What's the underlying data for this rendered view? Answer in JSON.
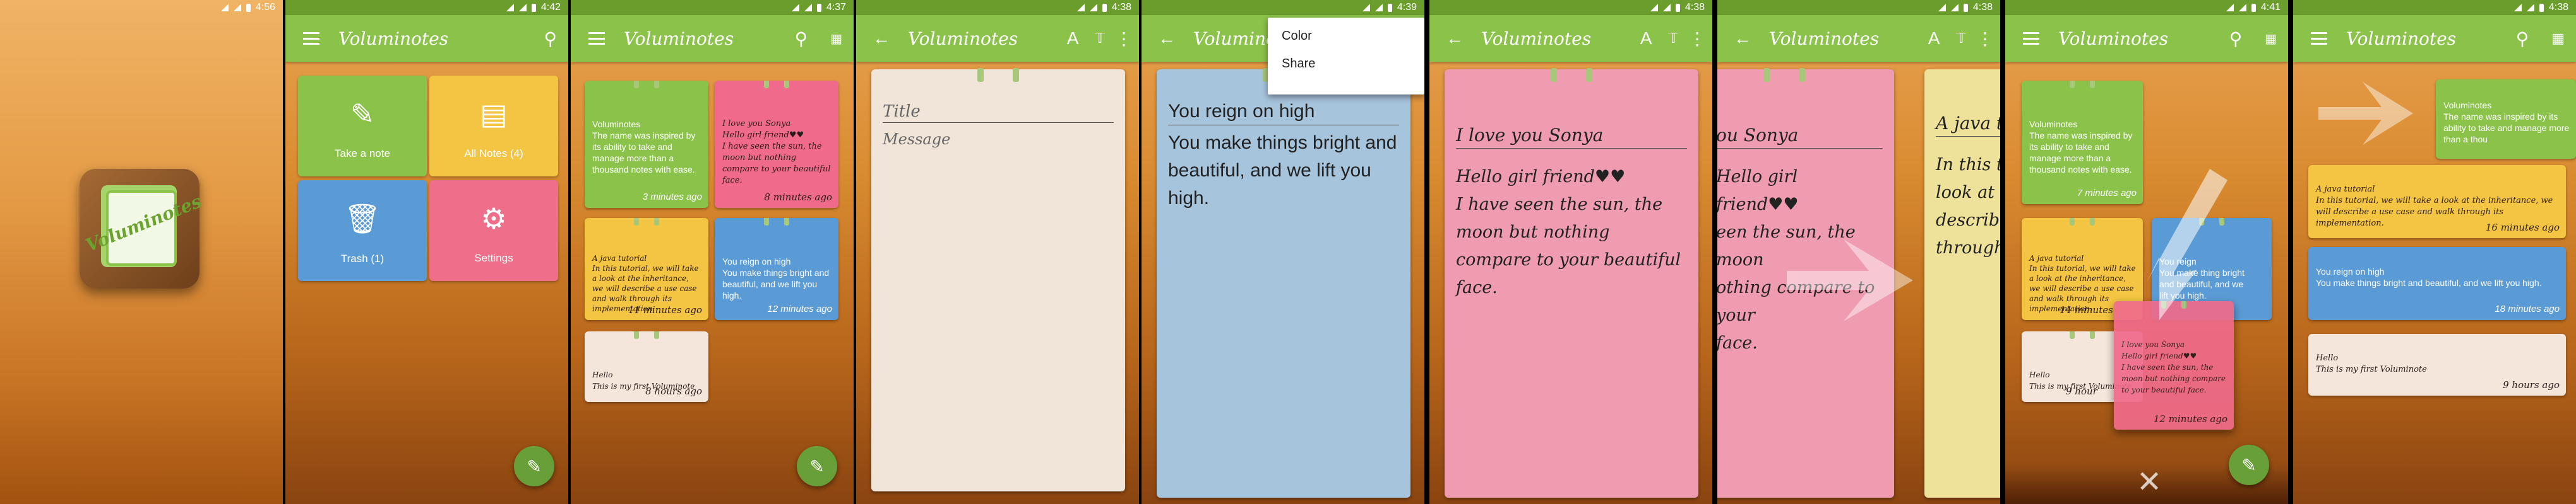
{
  "app": {
    "name": "Voluminotes",
    "brand_color": "#8bc34a",
    "dark_green": "#6a9d2c"
  },
  "status": {
    "s1": "4:56",
    "s2": "4:42",
    "s3": "4:37",
    "s4": "4:38",
    "s5": "4:39",
    "s6": "4:38",
    "s7": "4:38",
    "s8": "4:41",
    "s9": "4:38"
  },
  "splash": {
    "logo_text": "Voluminotes"
  },
  "home": {
    "tiles": [
      {
        "label": "Take a note",
        "icon": "pencil-icon",
        "color": "#8bc34a"
      },
      {
        "label": "All Notes (4)",
        "icon": "notes-icon",
        "color": "#f4c542"
      },
      {
        "label": "Trash (1)",
        "icon": "trash-icon",
        "color": "#5b9bd5"
      },
      {
        "label": "Settings",
        "icon": "gear-icon",
        "color": "#ef6f8b"
      }
    ]
  },
  "notes": [
    {
      "body": "Voluminotes\nThe name was inspired by its ability to take and manage more than a thousand notes with ease.",
      "time": "3 minutes ago",
      "color": "#8bc34a"
    },
    {
      "body": "I love you Sonya\nHello girl friend♥♥\nI have seen the sun, the moon but nothing compare to your beautiful face.",
      "time": "8 minutes ago",
      "color": "#f06b8b"
    },
    {
      "body": "A java tutorial\nIn this tutorial, we will take a look at the inheritance, we will describe a use case and walk through its implementation.",
      "time": "11 minutes ago",
      "color": "#f4c542"
    },
    {
      "body": "You reign on high\nYou make things bright and beautiful, and we lift you high.",
      "time": "12 minutes ago",
      "color": "#5b9bd5"
    },
    {
      "body": "Hello\nThis is my first Voluminote",
      "time": "8 hours ago",
      "color": "#f5e6dc"
    }
  ],
  "editor_new": {
    "title_placeholder": "Title",
    "message_placeholder": "Message"
  },
  "editor_blue": {
    "title": "You reign on high",
    "message": "You make things bright and beautiful, and we lift you high.",
    "menu": [
      "Color",
      "Share"
    ]
  },
  "editor_pink": {
    "title": "I love you Sonya",
    "message": "Hello girl friend♥♥\nI have seen the sun, the moon but nothing compare to your beautiful face."
  },
  "swipe": {
    "left_title": "ou Sonya",
    "left_message": "Hello girl friend♥♥\neen the sun, the moon\nothing compare to your\nface.",
    "right_title": "A java t",
    "right_message": "In this t\nlook at t\ndescribe\nthrough"
  },
  "drag": {
    "times": [
      "7 minutes ago",
      "14 minutes",
      "9 hour",
      "12 minutes ago"
    ],
    "fragment": "You reign\nYou make thing bright\nand beautiful, and we\nlift you high."
  },
  "list": {
    "items": [
      {
        "body": "A java tutorial\nIn this tutorial, we will take a look at the inheritance, we will describe a use case and walk through its implementation.",
        "time": "16 minutes ago",
        "color": "#f4c542"
      },
      {
        "body": "You reign on high\nYou make things bright and beautiful, and we lift you high.",
        "time": "18 minutes ago",
        "color": "#5b9bd5"
      },
      {
        "body": "Hello\nThis is my first Voluminote",
        "time": "9 hours ago",
        "color": "#f5e6dc"
      }
    ],
    "dragged": "Voluminotes\nThe name was inspired by its ability to take and manage more than a thou"
  }
}
